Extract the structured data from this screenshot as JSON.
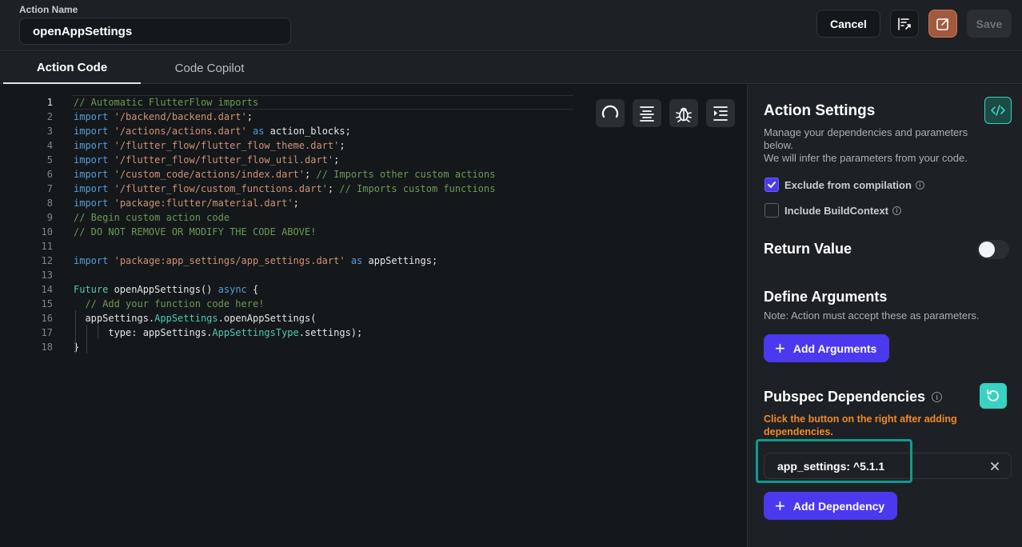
{
  "header": {
    "action_name_label": "Action Name",
    "action_name_value": "openAppSettings",
    "cancel_label": "Cancel",
    "save_label": "Save"
  },
  "tabs": [
    {
      "label": "Action Code",
      "active": true
    },
    {
      "label": "Code Copilot",
      "active": false
    }
  ],
  "editor": {
    "lines": [
      {
        "n": "1",
        "tokens": [
          [
            "c",
            "// Automatic FlutterFlow imports"
          ]
        ]
      },
      {
        "n": "2",
        "tokens": [
          [
            "k",
            "import"
          ],
          [
            "",
            " "
          ],
          [
            "s",
            "'/backend/backend.dart'"
          ],
          [
            "",
            ";"
          ]
        ]
      },
      {
        "n": "3",
        "tokens": [
          [
            "k",
            "import"
          ],
          [
            "",
            " "
          ],
          [
            "s",
            "'/actions/actions.dart'"
          ],
          [
            "",
            " "
          ],
          [
            "k",
            "as"
          ],
          [
            "",
            " action_blocks;"
          ]
        ]
      },
      {
        "n": "4",
        "tokens": [
          [
            "k",
            "import"
          ],
          [
            "",
            " "
          ],
          [
            "s",
            "'/flutter_flow/flutter_flow_theme.dart'"
          ],
          [
            "",
            ";"
          ]
        ]
      },
      {
        "n": "5",
        "tokens": [
          [
            "k",
            "import"
          ],
          [
            "",
            " "
          ],
          [
            "s",
            "'/flutter_flow/flutter_flow_util.dart'"
          ],
          [
            "",
            ";"
          ]
        ]
      },
      {
        "n": "6",
        "tokens": [
          [
            "k",
            "import"
          ],
          [
            "",
            " "
          ],
          [
            "s",
            "'/custom_code/actions/index.dart'"
          ],
          [
            "",
            "; "
          ],
          [
            "c",
            "// Imports other custom actions"
          ]
        ]
      },
      {
        "n": "7",
        "tokens": [
          [
            "k",
            "import"
          ],
          [
            "",
            " "
          ],
          [
            "s",
            "'/flutter_flow/custom_functions.dart'"
          ],
          [
            "",
            "; "
          ],
          [
            "c",
            "// Imports custom functions"
          ]
        ]
      },
      {
        "n": "8",
        "tokens": [
          [
            "k",
            "import"
          ],
          [
            "",
            " "
          ],
          [
            "s",
            "'package:flutter/material.dart'"
          ],
          [
            "",
            ";"
          ]
        ]
      },
      {
        "n": "9",
        "tokens": [
          [
            "c",
            "// Begin custom action code"
          ]
        ]
      },
      {
        "n": "10",
        "tokens": [
          [
            "c",
            "// DO NOT REMOVE OR MODIFY THE CODE ABOVE!"
          ]
        ]
      },
      {
        "n": "11",
        "tokens": []
      },
      {
        "n": "12",
        "tokens": [
          [
            "k",
            "import"
          ],
          [
            "",
            " "
          ],
          [
            "s",
            "'package:app_settings/app_settings.dart'"
          ],
          [
            "",
            " "
          ],
          [
            "k",
            "as"
          ],
          [
            "",
            " appSettings;"
          ]
        ]
      },
      {
        "n": "13",
        "tokens": []
      },
      {
        "n": "14",
        "tokens": [
          [
            "t",
            "Future"
          ],
          [
            "",
            " openAppSettings() "
          ],
          [
            "k",
            "async"
          ],
          [
            "",
            " {"
          ]
        ]
      },
      {
        "n": "15",
        "tokens": [
          [
            "",
            "  "
          ],
          [
            "c",
            "// Add your function code here!"
          ]
        ]
      },
      {
        "n": "16",
        "tokens": [
          [
            "",
            "  appSettings."
          ],
          [
            "t",
            "AppSettings"
          ],
          [
            "",
            ".openAppSettings("
          ]
        ]
      },
      {
        "n": "17",
        "tokens": [
          [
            "",
            "      type: appSettings."
          ],
          [
            "t",
            "AppSettingsType"
          ],
          [
            "",
            ".settings);"
          ]
        ]
      },
      {
        "n": "18",
        "tokens": [
          [
            "",
            "}"
          ]
        ]
      }
    ],
    "tool_icons": [
      "refresh-icon",
      "format-align-icon",
      "debug-bug-icon",
      "indent-icon"
    ]
  },
  "panel": {
    "title": "Action Settings",
    "description_1": "Manage your dependencies and parameters below.",
    "description_2": "We will infer the parameters from your code.",
    "exclude_label": "Exclude from compilation",
    "exclude_checked": true,
    "build_context_label": "Include BuildContext",
    "build_context_checked": false,
    "return_value_title": "Return Value",
    "return_value_on": false,
    "define_args_title": "Define Arguments",
    "define_args_note": "Note: Action must accept these as parameters.",
    "add_args_label": "Add Arguments",
    "pubspec_title": "Pubspec Dependencies",
    "pubspec_warning": "Click the button on the right after adding dependencies.",
    "dependency_value": "app_settings: ^5.1.1",
    "add_dependency_label": "Add Dependency"
  },
  "colors": {
    "accent_purple": "#4B39EF",
    "accent_teal": "#39D2C0",
    "warning_orange": "#F08A24",
    "highlight_teal": "#0F9B8E"
  }
}
